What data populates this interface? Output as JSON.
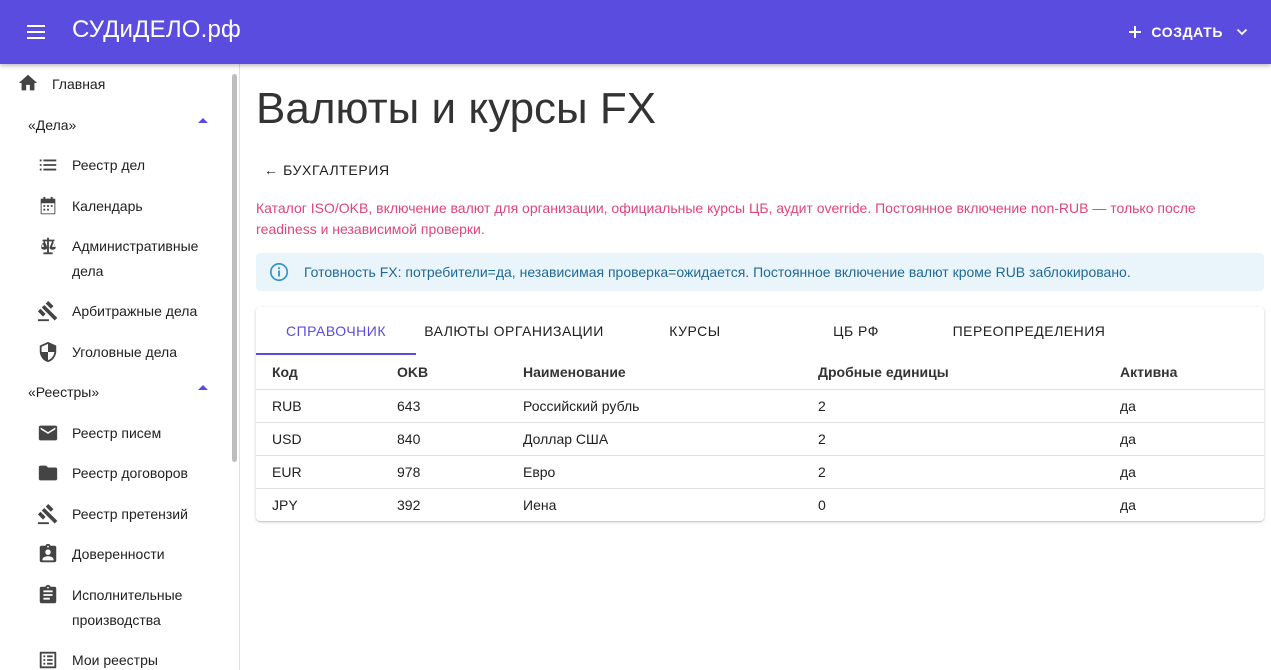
{
  "app": {
    "brand": "СУДиДЕЛО.рф",
    "create_label": "СОЗДАТЬ"
  },
  "sidebar": {
    "home": "Главная",
    "groups": [
      {
        "label": "«Дела»",
        "items": [
          "Реестр дел",
          "Календарь",
          "Административные дела",
          "Арбитражные дела",
          "Уголовные дела"
        ]
      },
      {
        "label": "«Реестры»",
        "items": [
          "Реестр писем",
          "Реестр договоров",
          "Реестр претензий",
          "Доверенности",
          "Исполнительные производства",
          "Мои реестры"
        ]
      }
    ]
  },
  "page": {
    "title": "Валюты и курсы FX",
    "back_label": "← БУХГАЛТЕРИЯ",
    "description": "Каталог ISO/OKB, включение валют для организации, официальные курсы ЦБ, аудит override. Постоянное включение non-RUB — только после readiness и независимой проверки.",
    "alert": "Готовность FX: потребители=да, независимая проверка=ожидается. Постоянное включение валют кроме RUB заблокировано."
  },
  "tabs": [
    "СПРАВОЧНИК",
    "ВАЛЮТЫ ОРГАНИЗАЦИИ",
    "КУРСЫ",
    "ЦБ РФ",
    "ПЕРЕОПРЕДЕЛЕНИЯ"
  ],
  "table": {
    "headers": [
      "Код",
      "OKB",
      "Наименование",
      "Дробные единицы",
      "Активна"
    ],
    "rows": [
      [
        "RUB",
        "643",
        "Российский рубль",
        "2",
        "да"
      ],
      [
        "USD",
        "840",
        "Доллар США",
        "2",
        "да"
      ],
      [
        "EUR",
        "978",
        "Евро",
        "2",
        "да"
      ],
      [
        "JPY",
        "392",
        "Иена",
        "0",
        "да"
      ]
    ]
  },
  "colors": {
    "primary": "#5b4ce0",
    "description": "#e0457b",
    "alert_bg": "#eaf4fb",
    "alert_text": "#1e6a99"
  }
}
